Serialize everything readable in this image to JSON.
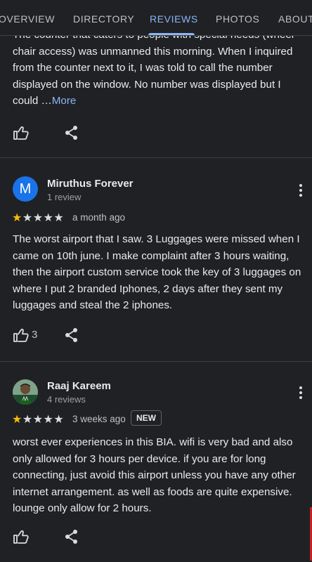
{
  "tabs": [
    {
      "label": "OVERVIEW",
      "active": false
    },
    {
      "label": "DIRECTORY",
      "active": false
    },
    {
      "label": "REVIEWS",
      "active": true
    },
    {
      "label": "PHOTOS",
      "active": false
    },
    {
      "label": "ABOUT",
      "active": false
    }
  ],
  "reviews": [
    {
      "text_lines": [
        "The counter that caters to people with special needs (wheel",
        "chair access) was unmanned this morning. When I inquired",
        "from the counter next to it, I was told to call the number",
        "displayed on the window. No number was displayed but I",
        "could …"
      ],
      "more_label": "More",
      "likes": ""
    },
    {
      "author": "Miruthus Forever",
      "avatar_letter": "M",
      "avatar_color": "#1a73e8",
      "subtitle": "1 review",
      "rating": 1,
      "max_rating": 5,
      "time": "a month ago",
      "text_lines": [
        "The worst airport that I saw. 3 Luggages were missed when I",
        "came on 10th june. I make complaint after 3 hours waiting,",
        "then the airport custom service took the key of 3 luggages on",
        "where I put 2 branded Iphones, 2 days after they sent my",
        "luggages and steal the 2 iphones."
      ],
      "likes": "3"
    },
    {
      "author": "Raaj Kareem",
      "avatar_type": "photo",
      "subtitle": "4 reviews",
      "rating": 1,
      "max_rating": 5,
      "time": "3 weeks ago",
      "badge": "NEW",
      "text_lines": [
        "worst ever experiences in this BIA. wifi is very bad and also",
        "only allowed for 3 hours per device. if you are for long",
        "connecting, just avoid this airport unless you have any other",
        "internet arrangement. as well as foods are quite expensive.",
        "lounge only allow for 2 hours."
      ],
      "likes": ""
    }
  ],
  "icons": {
    "like": "thumbs-up-icon",
    "share": "share-icon",
    "menu": "more-vert-icon",
    "star": "star-icon"
  },
  "colors": {
    "accent": "#8ab4f8",
    "star": "#fbbc04",
    "background": "#202124"
  }
}
